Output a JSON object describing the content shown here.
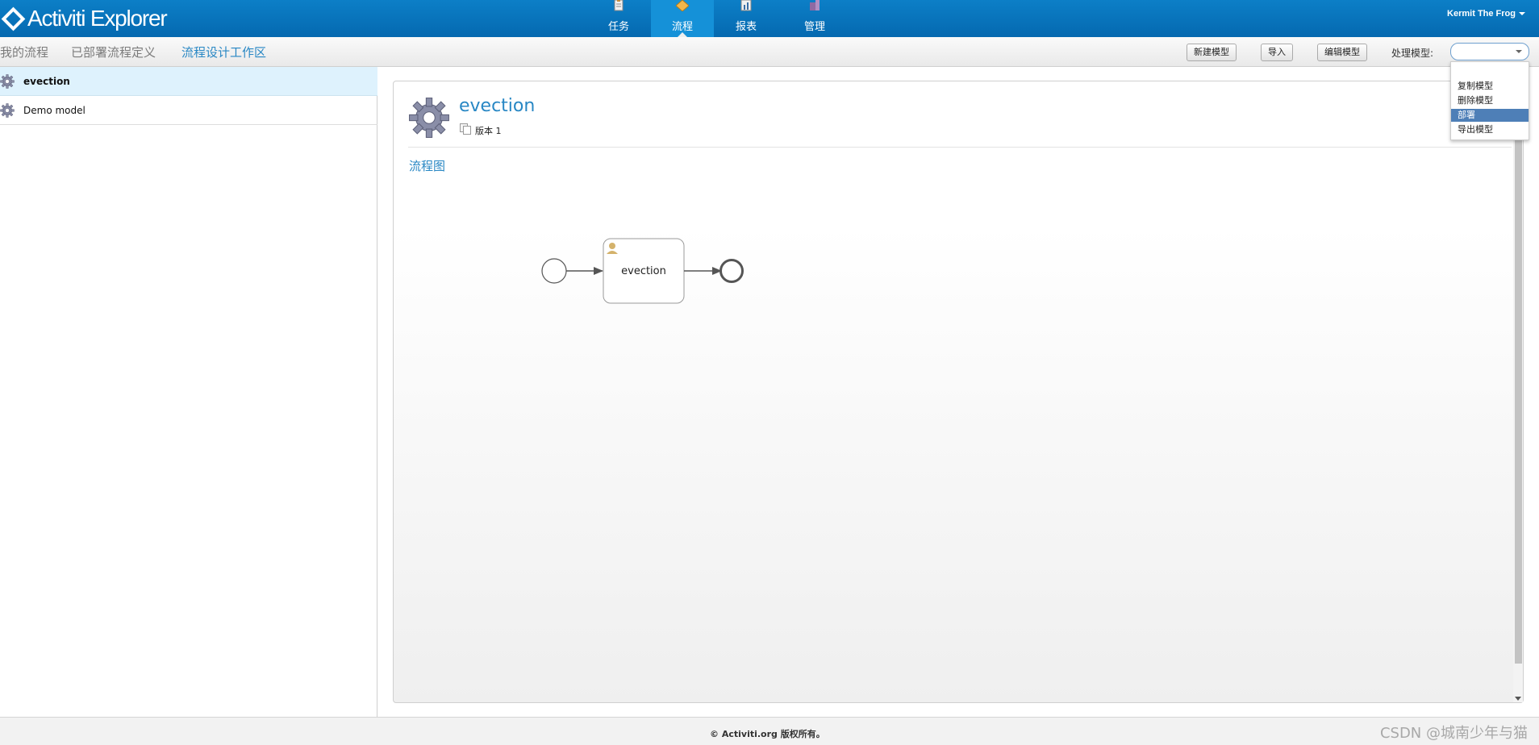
{
  "app": {
    "title": "Activiti Explorer"
  },
  "nav": {
    "items": [
      {
        "label": "任务",
        "icon": "task-clipboard-icon"
      },
      {
        "label": "流程",
        "icon": "process-diamond-icon",
        "active": true
      },
      {
        "label": "报表",
        "icon": "report-chart-icon"
      },
      {
        "label": "管理",
        "icon": "admin-building-icon"
      }
    ]
  },
  "user": {
    "name": "Kermit The Frog"
  },
  "subnav": {
    "tabs": [
      {
        "label": "我的流程"
      },
      {
        "label": "已部署流程定义"
      },
      {
        "label": "流程设计工作区",
        "active": true
      }
    ]
  },
  "toolbar": {
    "new_model_label": "新建模型",
    "import_label": "导入",
    "edit_model_label": "编辑模型",
    "process_model_label": "处理模型:",
    "process_model_value": ""
  },
  "dropdown": {
    "options": [
      {
        "label": "复制模型"
      },
      {
        "label": "删除模型"
      },
      {
        "label": "部署",
        "selected": true
      },
      {
        "label": "导出模型"
      }
    ]
  },
  "models": [
    {
      "name": "evection",
      "selected": true
    },
    {
      "name": "Demo model"
    }
  ],
  "detail": {
    "title": "evection",
    "version": "版本 1",
    "diagram_heading": "流程图",
    "diagram": {
      "task_label": "evection"
    }
  },
  "footer": {
    "copyright": "© Activiti.org 版权所有。",
    "watermark": "CSDN @城南少年与猫"
  },
  "colors": {
    "header_blue": "#0a76bf",
    "link_blue": "#2887c4",
    "selected_row": "#def2fd",
    "dropdown_selected": "#4e7fb7"
  }
}
